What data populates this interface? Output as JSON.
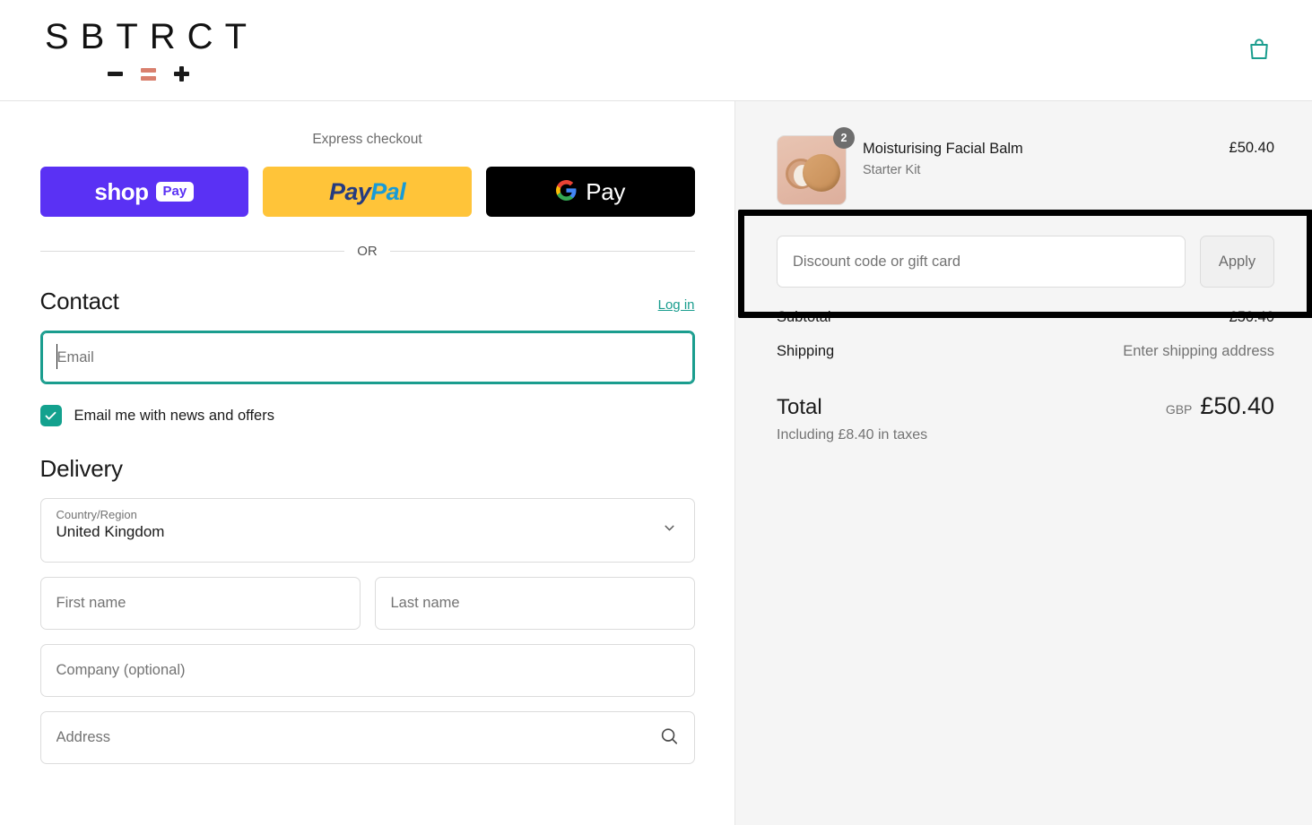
{
  "header": {
    "logo_text": "SBTRCT",
    "logo_symbols": [
      "minus",
      "equals",
      "plus"
    ],
    "bag_icon": "shopping-bag-icon"
  },
  "express": {
    "label": "Express checkout",
    "buttons": [
      {
        "id": "shop-pay",
        "word": "shop",
        "pill": "Pay",
        "bg": "#5A31F4"
      },
      {
        "id": "paypal",
        "word_a": "Pay",
        "word_b": "Pal",
        "bg": "#FFC439"
      },
      {
        "id": "google-pay",
        "word": "Pay",
        "bg": "#000000"
      }
    ],
    "divider_text": "OR"
  },
  "contact": {
    "title": "Contact",
    "login_label": "Log in",
    "email_placeholder": "Email",
    "email_value": "",
    "newsletter_label": "Email me with news and offers",
    "newsletter_checked": true
  },
  "delivery": {
    "title": "Delivery",
    "country_caption": "Country/Region",
    "country_value": "United Kingdom",
    "first_name_placeholder": "First name",
    "last_name_placeholder": "Last name",
    "company_placeholder": "Company (optional)",
    "address_placeholder": "Address"
  },
  "summary": {
    "item": {
      "title": "Moisturising Facial Balm",
      "variant": "Starter Kit",
      "price": "£50.40",
      "quantity": "2"
    },
    "discount_placeholder": "Discount code or gift card",
    "discount_value": "",
    "apply_label": "Apply",
    "subtotal_label": "Subtotal",
    "subtotal_value": "£50.40",
    "shipping_label": "Shipping",
    "shipping_value": "Enter shipping address",
    "total_label": "Total",
    "currency": "GBP",
    "total_value": "£50.40",
    "taxes_note": "Including £8.40 in taxes"
  },
  "colors": {
    "accent_teal": "#1a9d8e",
    "checkbox_teal": "#13a18e",
    "logo_coral": "#d9806e",
    "panel_bg": "#f5f5f5",
    "highlight": "#000000"
  }
}
